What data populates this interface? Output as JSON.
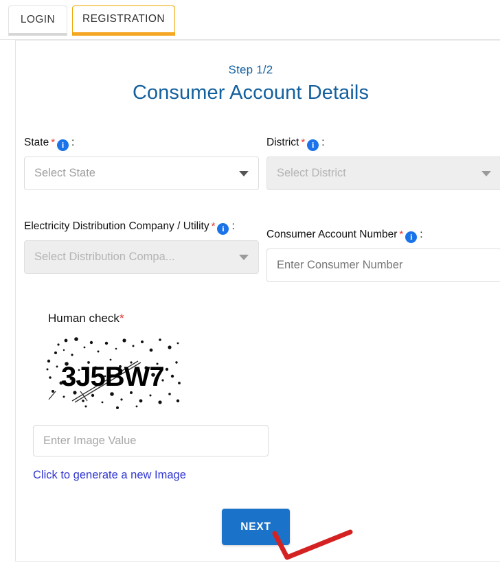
{
  "tabs": [
    {
      "label": "LOGIN",
      "active": false
    },
    {
      "label": "REGISTRATION",
      "active": true
    }
  ],
  "header": {
    "step": "Step 1/2",
    "title": "Consumer Account Details"
  },
  "form": {
    "state": {
      "label": "State",
      "required_marker": "*",
      "colon": ":",
      "info_glyph": "i",
      "placeholder": "Select State",
      "value": "",
      "disabled": false
    },
    "district": {
      "label": "District",
      "required_marker": "*",
      "colon": ":",
      "info_glyph": "i",
      "placeholder": "Select District",
      "value": "",
      "disabled": true
    },
    "utility": {
      "label": "Electricity Distribution Company / Utility",
      "required_marker": "*",
      "colon": ":",
      "info_glyph": "i",
      "placeholder": "Select Distribution Compa...",
      "value": "",
      "disabled": true
    },
    "consumer_account_number": {
      "label": "Consumer Account Number",
      "required_marker": "*",
      "colon": ":",
      "info_glyph": "i",
      "placeholder": "Enter Consumer Number",
      "value": "",
      "disabled": false
    }
  },
  "human_check": {
    "label": "Human check",
    "required_marker": "*",
    "captcha_text": "3J5BW7",
    "input_placeholder": "Enter Image Value",
    "input_value": "",
    "regenerate_link": "Click to generate a new Image"
  },
  "actions": {
    "next_label": "NEXT"
  },
  "colors": {
    "tab_active_border": "#f5a623",
    "title_blue": "#14609e",
    "primary_button": "#1a73c8",
    "info_icon": "#1a73e8",
    "required_star": "#e53935",
    "link_blue": "#2f35d1",
    "annotation_red": "#d42222"
  }
}
